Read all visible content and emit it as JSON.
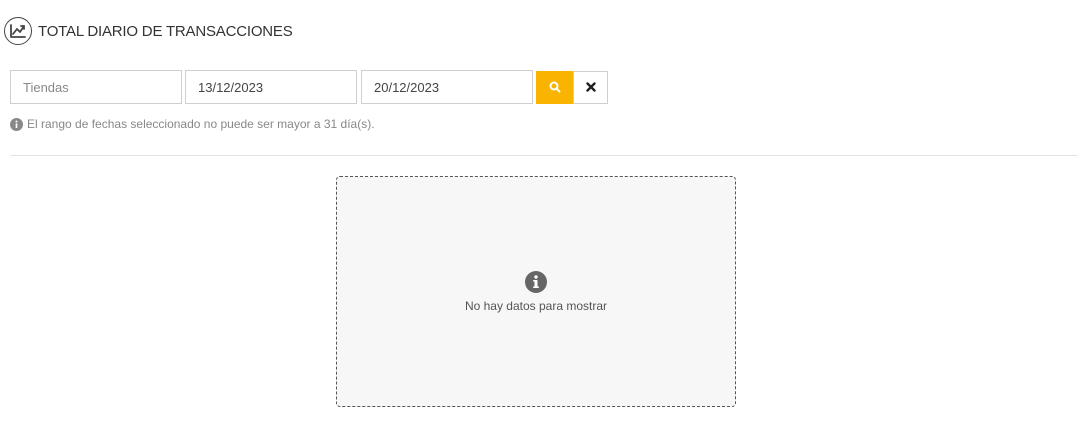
{
  "header": {
    "title": "TOTAL DIARIO DE TRANSACCIONES",
    "icon": "trend-chart-icon"
  },
  "filters": {
    "store_placeholder": "Tiendas",
    "date_from": "13/12/2023",
    "date_to": "20/12/2023",
    "search_icon": "search-icon",
    "clear_icon": "close-icon",
    "accent_color": "#f8b400"
  },
  "hint": {
    "icon": "info-icon",
    "text": "El rango de fechas seleccionado no puede ser mayor a 31 día(s)."
  },
  "empty_state": {
    "icon": "info-icon",
    "message": "No hay datos para mostrar"
  }
}
